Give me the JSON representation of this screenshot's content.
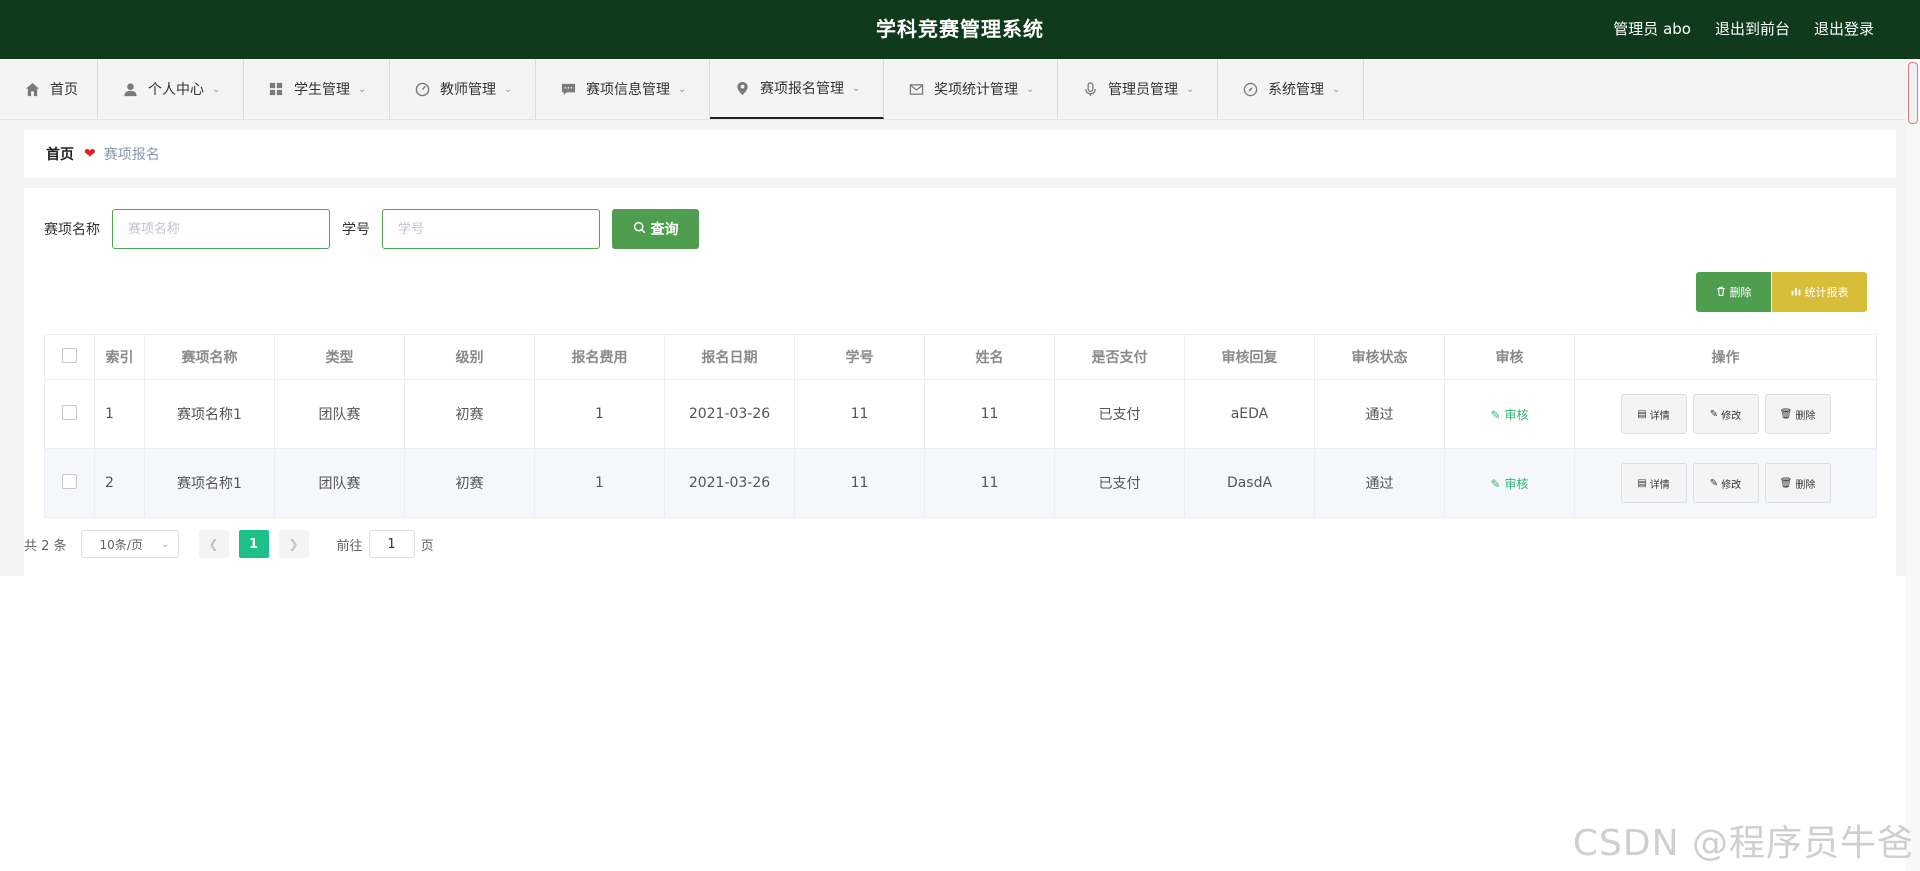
{
  "header": {
    "title": "学科竞赛管理系统",
    "user": "管理员 abo",
    "to_front": "退出到前台",
    "logout": "退出登录"
  },
  "nav": {
    "items": [
      {
        "label": "首页",
        "icon": "home-icon"
      },
      {
        "label": "个人中心",
        "icon": "user-icon"
      },
      {
        "label": "学生管理",
        "icon": "grid-icon"
      },
      {
        "label": "教师管理",
        "icon": "gauge-icon"
      },
      {
        "label": "赛项信息管理",
        "icon": "message-icon"
      },
      {
        "label": "赛项报名管理",
        "icon": "location-icon"
      },
      {
        "label": "奖项统计管理",
        "icon": "mail-icon"
      },
      {
        "label": "管理员管理",
        "icon": "microphone-icon"
      },
      {
        "label": "系统管理",
        "icon": "compass-icon"
      }
    ],
    "active": "赛项报名管理"
  },
  "breadcrumb": {
    "home": "首页",
    "current": "赛项报名"
  },
  "search": {
    "name_label": "赛项名称",
    "name_placeholder": "赛项名称",
    "id_label": "学号",
    "id_placeholder": "学号",
    "query_label": "查询"
  },
  "actions": {
    "delete_label": "删除",
    "stats_label": "统计报表"
  },
  "table": {
    "columns": [
      "索引",
      "赛项名称",
      "类型",
      "级别",
      "报名费用",
      "报名日期",
      "学号",
      "姓名",
      "是否支付",
      "审核回复",
      "审核状态",
      "审核",
      "操作"
    ],
    "rows": [
      {
        "idx": "1",
        "name": "赛项名称1",
        "type": "团队赛",
        "level": "初赛",
        "fee": "1",
        "date": "2021-03-26",
        "sid": "11",
        "sname": "11",
        "paid": "已支付",
        "reply": "aEDA",
        "status": "通过"
      },
      {
        "idx": "2",
        "name": "赛项名称1",
        "type": "团队赛",
        "level": "初赛",
        "fee": "1",
        "date": "2021-03-26",
        "sid": "11",
        "sname": "11",
        "paid": "已支付",
        "reply": "DasdA",
        "status": "通过"
      }
    ],
    "audit_label": "审核",
    "detail_label": "详情",
    "edit_label": "修改",
    "delete_label": "删除"
  },
  "pager": {
    "total": "共 2 条",
    "page_size": "10条/页",
    "current_page": "1",
    "goto_label": "前往",
    "goto_value": "1",
    "page_suffix": "页"
  },
  "watermark": "CSDN @程序员牛爸",
  "colors": {
    "header_bg": "#0f3b1c",
    "primary_green": "#4f9e4f",
    "stats_yellow": "#d8be38",
    "page_active": "#1ec08a",
    "audit_link": "#2eb872"
  }
}
